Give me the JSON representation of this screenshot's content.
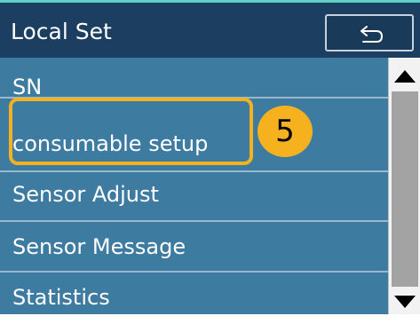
{
  "header": {
    "title": "Local Set",
    "back_icon": "back-arrow-icon"
  },
  "menu": {
    "items": [
      {
        "label": "SN"
      },
      {
        "label": "consumable setup"
      },
      {
        "label": "Sensor Adjust"
      },
      {
        "label": "Sensor Message"
      },
      {
        "label": "Statistics"
      }
    ]
  },
  "annotation": {
    "step_number": "5",
    "highlight_target": "consumable setup",
    "color": "#f5b21e"
  },
  "scrollbar": {
    "up_icon": "triangle-up-icon",
    "down_icon": "triangle-down-icon"
  },
  "colors": {
    "header_bg": "#1c3e60",
    "list_bg": "#3e7ba1",
    "accent": "#5fd0c4"
  }
}
